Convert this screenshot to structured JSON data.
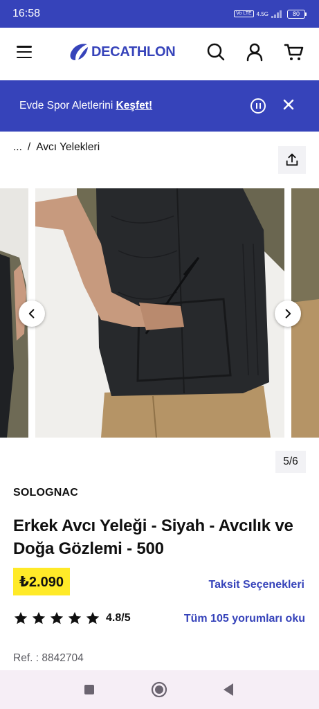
{
  "status_bar": {
    "time": "16:58",
    "volte": "Vo LTE",
    "network": "4.5G",
    "battery": "80"
  },
  "header": {
    "logo_text": "DECATHLON",
    "brand_color": "#3643ba"
  },
  "banner": {
    "text": "Evde Spor Aletlerini",
    "link": "Keşfet!"
  },
  "breadcrumb": {
    "ellipsis": "...",
    "separator": "/",
    "current": "Avcı Yelekleri"
  },
  "gallery": {
    "counter": "5/6"
  },
  "product": {
    "brand": "SOLOGNAC",
    "title": "Erkek Avcı Yeleği - Siyah - Avcılık ve Doğa Gözlemi - 500",
    "price": "₺2.090",
    "installments_link": "Taksit Seçenekleri",
    "rating_value": "4.8/5",
    "stars": 5,
    "reviews_link": "Tüm 105 yorumları oku",
    "ref": "Ref. : 8842704"
  },
  "colors": {
    "accent": "#3643ba",
    "price_highlight": "#ffea28"
  }
}
